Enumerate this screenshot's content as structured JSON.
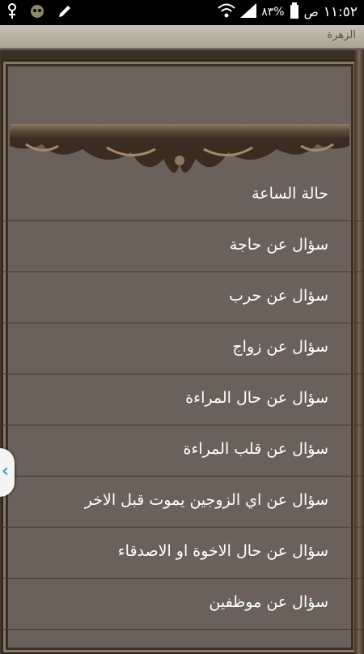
{
  "status_bar": {
    "time": "١١:٥٢",
    "am_pm": "ص",
    "battery": "٨٣%",
    "icons": [
      "usb-icon",
      "notification-icon",
      "edit-icon",
      "wifi-icon",
      "signal-icon",
      "battery-icon"
    ]
  },
  "app": {
    "title": "الزهرة"
  },
  "list": {
    "items": [
      {
        "label": "حالة الساعة"
      },
      {
        "label": "سؤال عن حاجة"
      },
      {
        "label": "سؤال عن حرب"
      },
      {
        "label": "سؤال عن زواج"
      },
      {
        "label": "سؤال عن حال المراءة"
      },
      {
        "label": "سؤال عن قلب المراءة"
      },
      {
        "label": "سؤال عن اي الزوجين يموت قبل الاخر"
      },
      {
        "label": "سؤال عن حال الاخوة او الاصدقاء"
      },
      {
        "label": "سؤال عن موظفين"
      }
    ]
  },
  "side_tab": {
    "glyph": "‹",
    "icon": "chevron-left-icon"
  },
  "colors": {
    "background": "#5f5851",
    "frame": "#3b2f25",
    "text": "#ffffff",
    "tab_accent": "#3da0c4"
  }
}
